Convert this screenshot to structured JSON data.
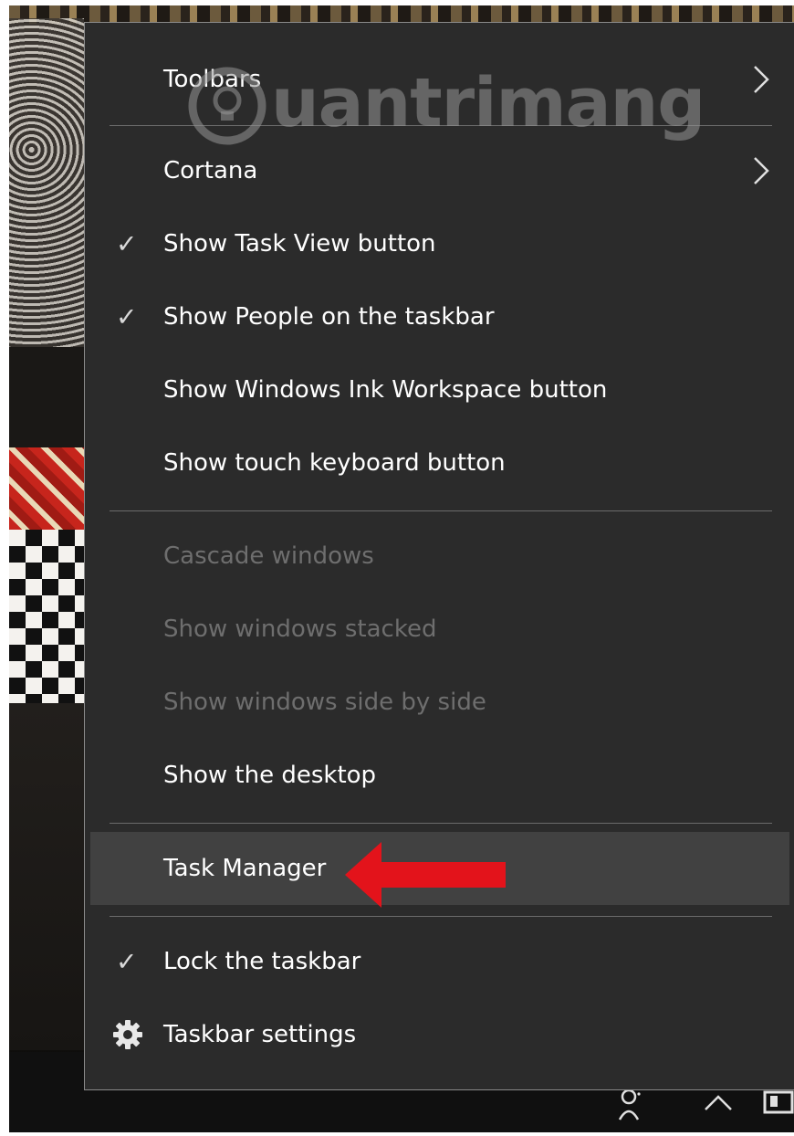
{
  "menu": {
    "items": [
      {
        "label": "Toolbars",
        "checked": false,
        "submenu": true,
        "enabled": true
      },
      {
        "label": "Cortana",
        "checked": false,
        "submenu": true,
        "enabled": true
      },
      {
        "label": "Show Task View button",
        "checked": true,
        "submenu": false,
        "enabled": true
      },
      {
        "label": "Show People on the taskbar",
        "checked": true,
        "submenu": false,
        "enabled": true
      },
      {
        "label": "Show Windows Ink Workspace button",
        "checked": false,
        "submenu": false,
        "enabled": true
      },
      {
        "label": "Show touch keyboard button",
        "checked": false,
        "submenu": false,
        "enabled": true
      },
      {
        "label": "Cascade windows",
        "checked": false,
        "submenu": false,
        "enabled": false
      },
      {
        "label": "Show windows stacked",
        "checked": false,
        "submenu": false,
        "enabled": false
      },
      {
        "label": "Show windows side by side",
        "checked": false,
        "submenu": false,
        "enabled": false
      },
      {
        "label": "Show the desktop",
        "checked": false,
        "submenu": false,
        "enabled": true
      },
      {
        "label": "Task Manager",
        "checked": false,
        "submenu": false,
        "enabled": true,
        "highlighted": true
      },
      {
        "label": "Lock the taskbar",
        "checked": true,
        "submenu": false,
        "enabled": true
      },
      {
        "label": "Taskbar settings",
        "checked": false,
        "submenu": false,
        "enabled": true,
        "icon": "gear-icon"
      }
    ],
    "check_glyph": "✓"
  },
  "watermark": {
    "text": "uantrimang"
  },
  "icons": {
    "chevron": "chevron-right-icon",
    "settings": "gear-icon",
    "annotation": "red-arrow-icon",
    "tray_people": "people-icon",
    "tray_up": "chevron-up-icon",
    "tray_action": "action-center-icon"
  },
  "colors": {
    "menu_bg": "#2b2b2b",
    "highlight_bg": "#414141",
    "text": "#ffffff",
    "disabled_text": "#6e6e6e",
    "separator": "#6b6b6b",
    "arrow": "#e3131b"
  }
}
